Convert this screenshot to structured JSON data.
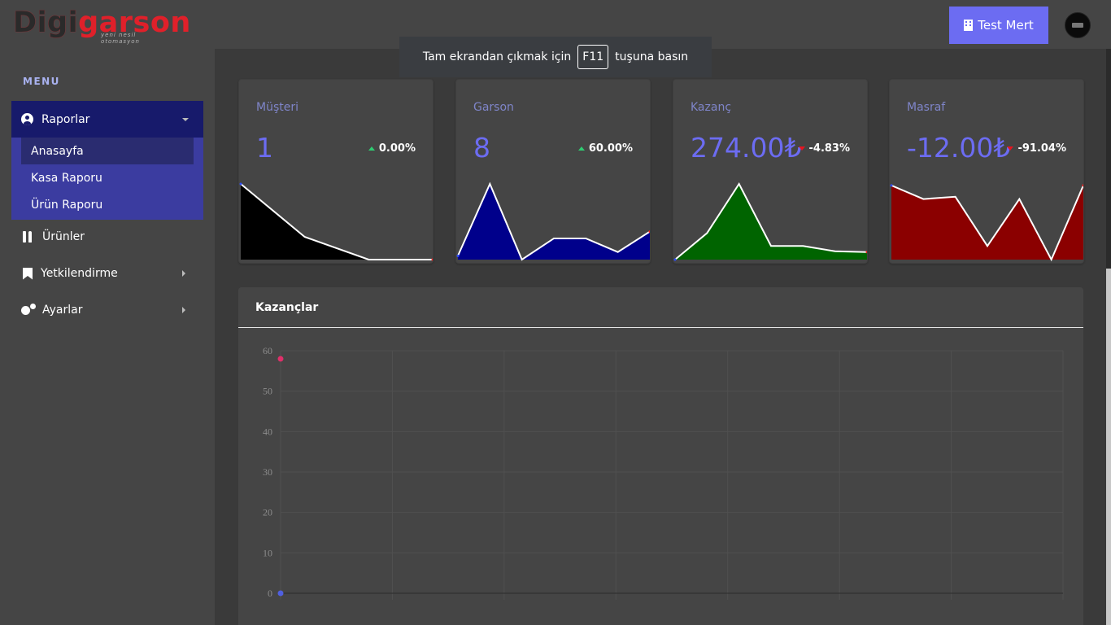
{
  "brand": {
    "logo_prefix": "D",
    "logo_mid": "igi",
    "logo_suffix": "garson",
    "tagline": "yeni nesil otomasyon"
  },
  "header": {
    "user_label": "Test Mert",
    "user_icon": "building-icon",
    "avatar_icon": "avatar-icon"
  },
  "toast": {
    "before": "Tam ekrandan çıkmak için",
    "key": "F11",
    "after": "tuşuna basın"
  },
  "sidebar": {
    "menu_title": "MENU",
    "group": {
      "label": "Raporlar",
      "icon": "user-circle-icon",
      "items": [
        {
          "label": "Anasayfa",
          "active": true
        },
        {
          "label": "Kasa Raporu",
          "active": false
        },
        {
          "label": "Ürün Raporu",
          "active": false
        }
      ]
    },
    "items": [
      {
        "label": "Ürünler",
        "icon": "utensils-icon"
      },
      {
        "label": "Yetkilendirme",
        "icon": "bookmark-icon"
      },
      {
        "label": "Ayarlar",
        "icon": "cogs-icon"
      }
    ]
  },
  "cards": [
    {
      "label": "Müşteri",
      "value": "1",
      "change": "0.00%",
      "trend": "up",
      "fill": "#000000",
      "series": [
        1.0,
        0.3,
        0.0,
        0.0
      ]
    },
    {
      "label": "Garson",
      "value": "8",
      "change": "60.00%",
      "trend": "up",
      "fill": "#00008b",
      "series": [
        0.05,
        1.0,
        0.0,
        0.28,
        0.28,
        0.1,
        0.37
      ]
    },
    {
      "label": "Kazanç",
      "value": "274.00₺",
      "change": "-4.83%",
      "trend": "down",
      "fill": "#006400",
      "series": [
        0.0,
        0.35,
        1.0,
        0.18,
        0.18,
        0.11,
        0.1
      ]
    },
    {
      "label": "Masraf",
      "value": "-12.00₺",
      "change": "-91.04%",
      "trend": "down",
      "fill": "#8b0000",
      "series": [
        0.98,
        0.8,
        0.83,
        0.18,
        0.8,
        0.0,
        0.98
      ]
    }
  ],
  "earnings_panel": {
    "title": "Kazançlar"
  },
  "chart_data": {
    "type": "line",
    "title": "",
    "ylim": [
      0,
      60
    ],
    "yticks": [
      "0",
      "10",
      "20",
      "30",
      "40",
      "50",
      "60"
    ],
    "series": [
      {
        "color": "#e0306a",
        "points": [
          {
            "x": 0,
            "y": 58
          }
        ]
      },
      {
        "color": "#5060e0",
        "points": [
          {
            "x": 0,
            "y": 0
          }
        ]
      }
    ],
    "grid": true
  }
}
